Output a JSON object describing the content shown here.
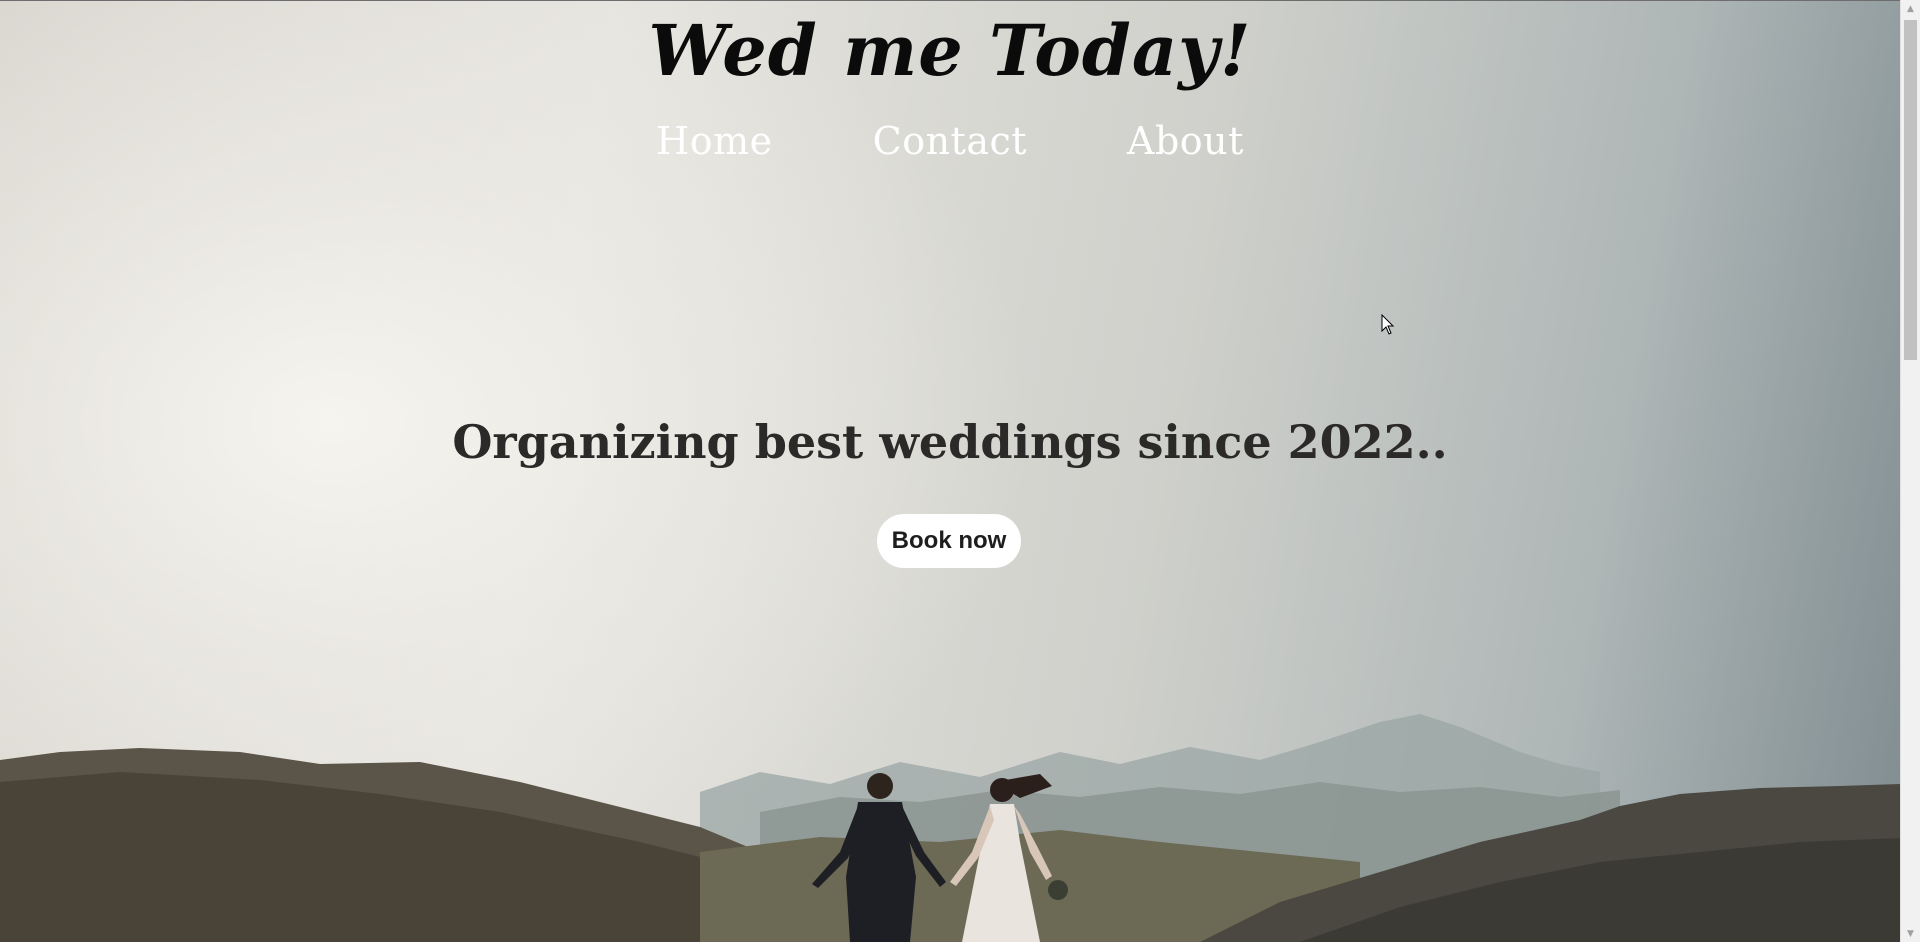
{
  "brand": {
    "title": "Wed me Today!"
  },
  "nav": {
    "items": [
      {
        "label": "Home"
      },
      {
        "label": "Contact"
      },
      {
        "label": "About"
      }
    ]
  },
  "hero": {
    "tagline": "Organizing best weddings since 2022..",
    "cta_label": "Book now",
    "image_description_icon": "couple-landscape-photo"
  },
  "colors": {
    "brand_text": "#0b0b0b",
    "nav_text": "#ffffff",
    "tagline_text": "#2b2a28",
    "button_bg": "#ffffff",
    "button_text": "#1e1e1e"
  }
}
